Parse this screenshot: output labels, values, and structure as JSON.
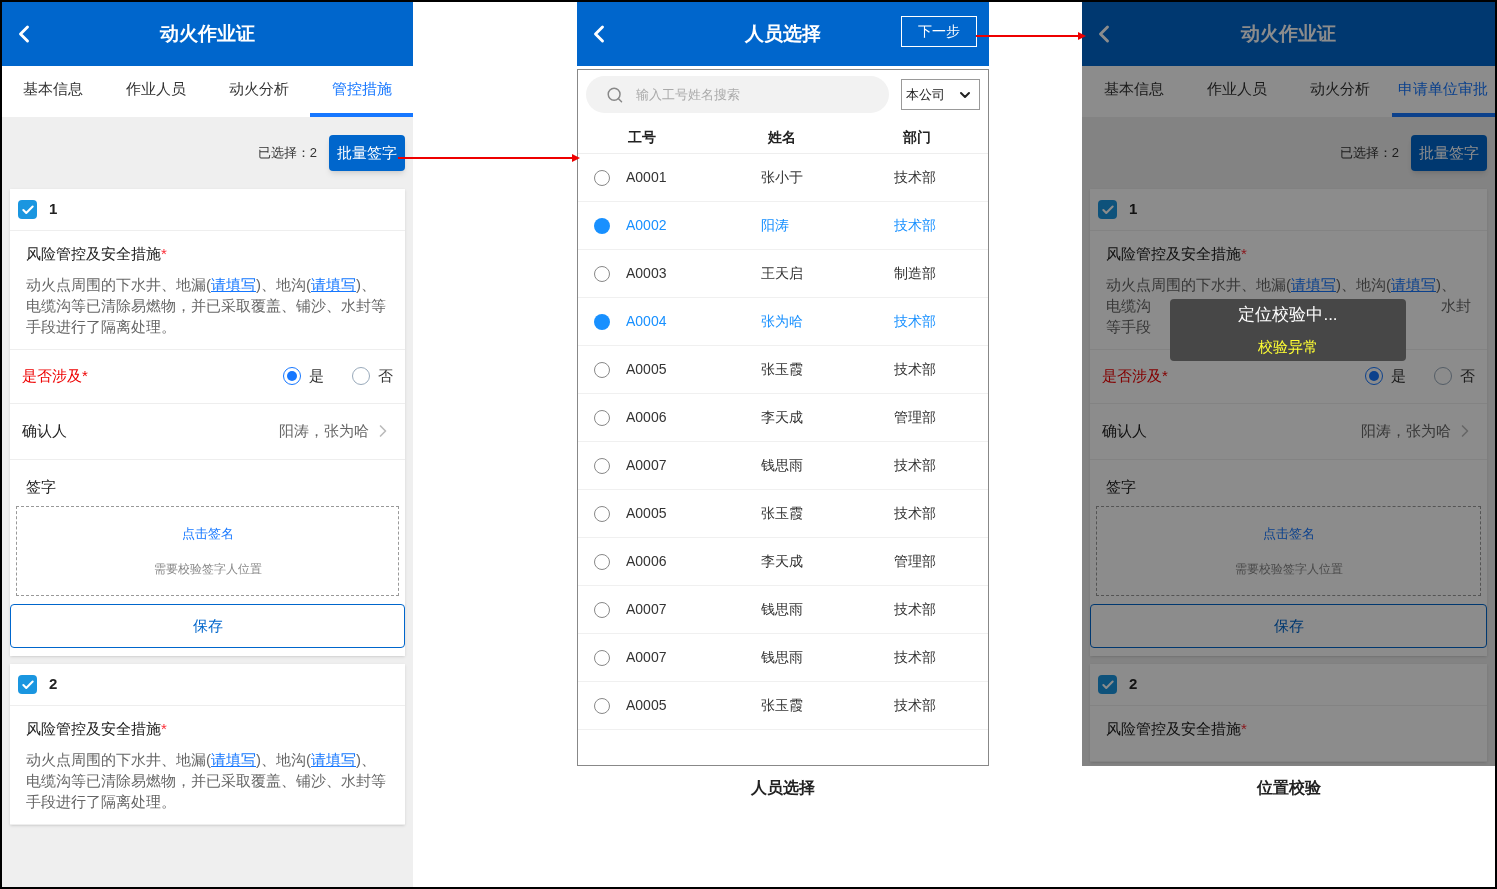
{
  "form_screen": {
    "title": "动火作业证",
    "tabs": [
      {
        "label": "基本信息",
        "selected": false
      },
      {
        "label": "作业人员",
        "selected": false
      },
      {
        "label": "动火分析",
        "selected": false
      },
      {
        "label": "管控措施",
        "selected": true
      }
    ],
    "selected_count": "已选择：2",
    "batch_sign_button": "批量签字",
    "items": [
      {
        "index": "1",
        "checked": true,
        "measure_label": "风险管控及安全措施",
        "required_mark": "*",
        "measure_text": [
          {
            "kind": "plain",
            "text": "动火点周围的下水井、地漏("
          },
          {
            "kind": "link",
            "text": "请填写"
          },
          {
            "kind": "plain",
            "text": ")、地沟("
          },
          {
            "kind": "link",
            "text": "请填写"
          },
          {
            "kind": "plain",
            "text": ")、电缆沟等已清除易燃物，并已采取覆盖、铺沙、水封等手段进行了隔离处理。"
          }
        ],
        "involve": {
          "label": "是否涉及",
          "required_mark": "*",
          "options": [
            {
              "label": "是",
              "selected": true
            },
            {
              "label": "否",
              "selected": false
            }
          ]
        },
        "confirmer": {
          "label": "确认人",
          "value": "阳涛，张为哈"
        },
        "signature": {
          "label": "签字",
          "action": "点击签名",
          "hint": "需要校验签字人位置"
        },
        "save_button": "保存"
      },
      {
        "index": "2",
        "checked": true,
        "measure_label": "风险管控及安全措施",
        "required_mark": "*",
        "measure_text": [
          {
            "kind": "plain",
            "text": "动火点周围的下水井、地漏("
          },
          {
            "kind": "link",
            "text": "请填写"
          },
          {
            "kind": "plain",
            "text": ")、地沟("
          },
          {
            "kind": "link",
            "text": "请填写"
          },
          {
            "kind": "plain",
            "text": ")、电缆沟等已清除易燃物，并已采取覆盖、铺沙、水封等手段进行了隔离处理。"
          }
        ]
      }
    ]
  },
  "picker_screen": {
    "title": "人员选择",
    "next_button": "下一步",
    "search": {
      "placeholder": "输入工号姓名搜索"
    },
    "scope_select": "本公司",
    "columns": [
      "工号",
      "姓名",
      "部门"
    ],
    "rows": [
      {
        "id": "A0001",
        "name": "张小于",
        "dept": "技术部",
        "selected": false
      },
      {
        "id": "A0002",
        "name": "阳涛",
        "dept": "技术部",
        "selected": true
      },
      {
        "id": "A0003",
        "name": "王天启",
        "dept": "制造部",
        "selected": false
      },
      {
        "id": "A0004",
        "name": "张为哈",
        "dept": "技术部",
        "selected": true
      },
      {
        "id": "A0005",
        "name": "张玉霞",
        "dept": "技术部",
        "selected": false
      },
      {
        "id": "A0006",
        "name": "李天成",
        "dept": "管理部",
        "selected": false
      },
      {
        "id": "A0007",
        "name": "钱思雨",
        "dept": "技术部",
        "selected": false
      },
      {
        "id": "A0005",
        "name": "张玉霞",
        "dept": "技术部",
        "selected": false
      },
      {
        "id": "A0006",
        "name": "李天成",
        "dept": "管理部",
        "selected": false
      },
      {
        "id": "A0007",
        "name": "钱思雨",
        "dept": "技术部",
        "selected": false
      },
      {
        "id": "A0007",
        "name": "钱思雨",
        "dept": "技术部",
        "selected": false
      },
      {
        "id": "A0005",
        "name": "张玉霞",
        "dept": "技术部",
        "selected": false
      }
    ],
    "caption": "人员选择"
  },
  "verify_screen": {
    "title": "动火作业证",
    "tabs": [
      {
        "label": "基本信息",
        "selected": false
      },
      {
        "label": "作业人员",
        "selected": false
      },
      {
        "label": "动火分析",
        "selected": false
      },
      {
        "label": "申请单位审批",
        "selected": true
      }
    ],
    "selected_count": "已选择：2",
    "batch_sign_button": "批量签字",
    "items": [
      {
        "index": "1",
        "checked": true,
        "measure_label": "风险管控及安全措施",
        "required_mark": "*",
        "measure_lines": [
          {
            "left": [
              {
                "kind": "plain",
                "text": "动火点周围的下水井、地漏("
              },
              {
                "kind": "link",
                "text": "请填写"
              },
              {
                "kind": "plain",
                "text": ")、地沟("
              },
              {
                "kind": "link",
                "text": "请填写"
              },
              {
                "kind": "plain",
                "text": ")、"
              }
            ]
          },
          {
            "left": [
              {
                "kind": "plain",
                "text": "电缆沟"
              }
            ],
            "right": "水封"
          },
          {
            "left": [
              {
                "kind": "plain",
                "text": "等手段"
              }
            ]
          }
        ],
        "involve": {
          "label": "是否涉及",
          "required_mark": "*",
          "options": [
            {
              "label": "是",
              "selected": true
            },
            {
              "label": "否",
              "selected": false
            }
          ]
        },
        "confirmer": {
          "label": "确认人",
          "value": "阳涛，张为哈"
        },
        "signature": {
          "label": "签字",
          "action": "点击签名",
          "hint": "需要校验签字人位置"
        },
        "save_button": "保存"
      },
      {
        "index": "2",
        "checked": true,
        "measure_label": "风险管控及安全措施",
        "required_mark": "*"
      }
    ],
    "toast": {
      "message": "定位校验中...",
      "status": "校验异常"
    },
    "caption": "位置校验"
  }
}
